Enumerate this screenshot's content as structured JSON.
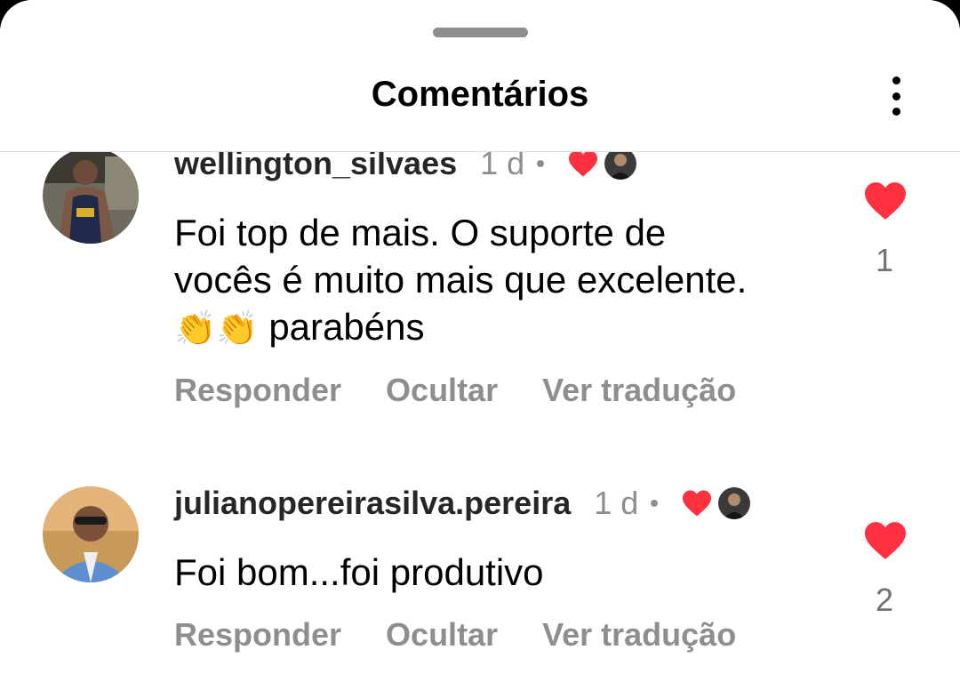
{
  "header": {
    "title": "Comentários"
  },
  "comments": [
    {
      "username": "wellington_silvaes",
      "time": "1 d",
      "text_lines": [
        "Foi top de mais. O suporte de",
        "vocês é muito mais que excelente."
      ],
      "text_tail": "parabéns",
      "emoji": "👏👏",
      "actions": {
        "reply": "Responder",
        "hide": "Ocultar",
        "translate": "Ver tradução"
      },
      "like_count": "1"
    },
    {
      "username": "julianopereirasilva.pereira",
      "time": "1 d",
      "text": "Foi bom...foi produtivo",
      "actions": {
        "reply": "Responder",
        "hide": "Ocultar",
        "translate": "Ver tradução"
      },
      "like_count": "2"
    }
  ],
  "colors": {
    "like_red": "#ff3040",
    "muted": "#8e8e8e",
    "text": "#000000"
  },
  "icons": [
    "more-vertical-icon",
    "heart-icon",
    "clap-emoji"
  ]
}
